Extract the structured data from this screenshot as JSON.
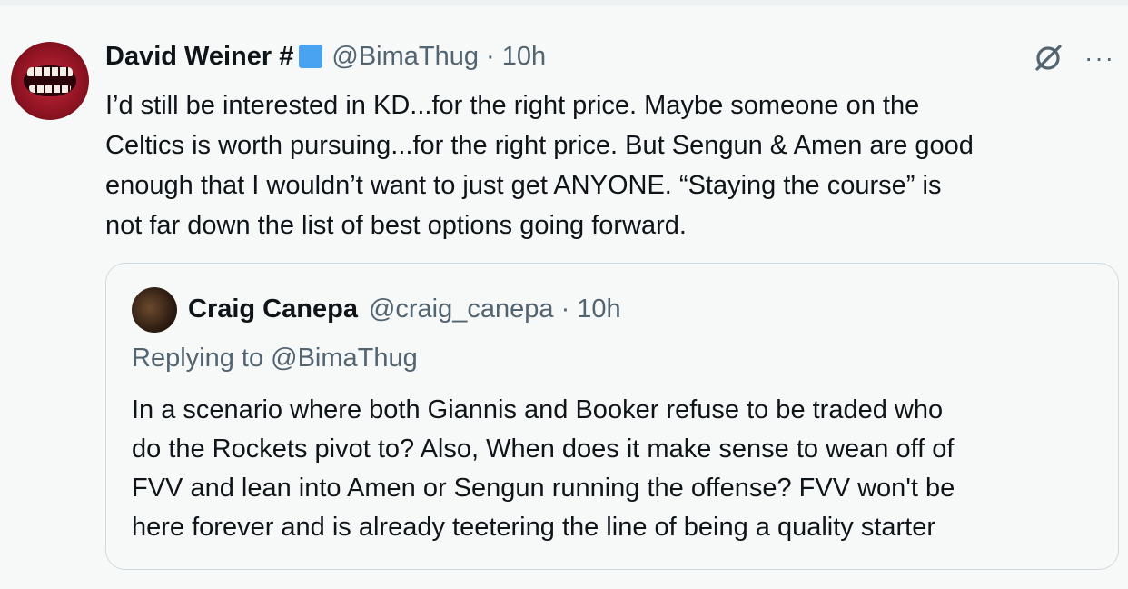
{
  "tweet": {
    "author_name": "David Weiner #",
    "meta": "@BimaThug · 10h",
    "badge_color": "#4aa3f0",
    "lines": [
      "I’d still be interested in KD...for the right price. Maybe someone on the",
      "Celtics is worth pursuing...for the right price. But Sengun & Amen are good",
      "enough that I wouldn’t want to just get ANYONE. “Staying the course” is",
      "not far down the list of best options going forward."
    ],
    "icons": {
      "grok": "grok-icon",
      "more": "more-options-icon"
    },
    "more_glyph": "···"
  },
  "quote": {
    "author_name": "Craig Canepa",
    "meta": "@craig_canepa · 10h",
    "reply_to": "Replying to @BimaThug",
    "lines": [
      "In a scenario where both Giannis and Booker refuse to be traded who",
      "do the Rockets pivot to? Also, When does it make sense to wean off of",
      "FVV and lean into Amen or Sengun running the offense? FVV won't be",
      "here forever and is already teetering the line of being a quality starter"
    ]
  }
}
